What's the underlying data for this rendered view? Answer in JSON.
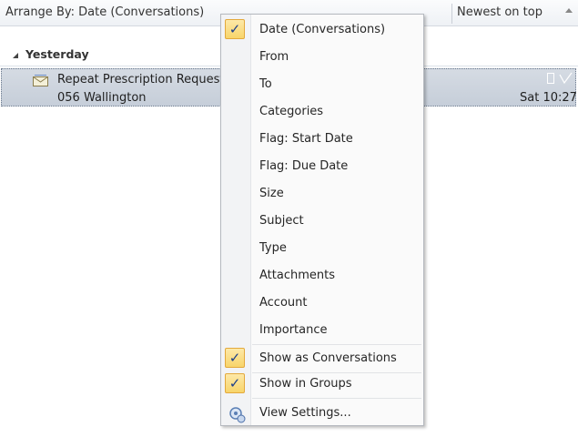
{
  "header": {
    "arrange_by": "Arrange By: Date (Conversations)",
    "sort_order": "Newest on top"
  },
  "group": {
    "label": "Yesterday"
  },
  "message": {
    "subject": "Repeat Prescription Request",
    "from": "056 Wallington",
    "time": "Sat 10:27",
    "icon": "envelope-icon"
  },
  "menu": {
    "items": [
      {
        "label": "Date (Conversations)",
        "checked": true
      },
      {
        "label": "From"
      },
      {
        "label": "To"
      },
      {
        "label": "Categories"
      },
      {
        "label": "Flag: Start Date"
      },
      {
        "label": "Flag: Due Date"
      },
      {
        "label": "Size"
      },
      {
        "label": "Subject"
      },
      {
        "label": "Type"
      },
      {
        "label": "Attachments"
      },
      {
        "label": "Account"
      },
      {
        "label": "Importance"
      },
      {
        "label": "Show as Conversations",
        "checked": true
      },
      {
        "label": "Show in Groups",
        "checked": true
      },
      {
        "label": "View Settings...",
        "icon": "view-settings-icon"
      }
    ]
  },
  "colors": {
    "check_bg": "#f8d56a",
    "selection_bg": "#c9d1dc",
    "check_mark": "#1d3f8a"
  }
}
